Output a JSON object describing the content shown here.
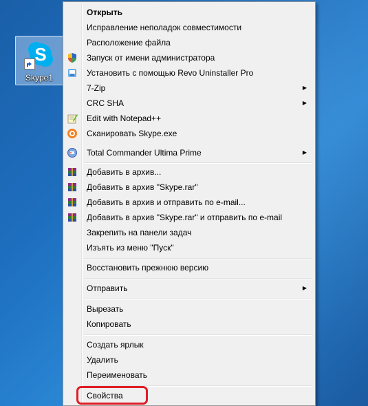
{
  "desktop": {
    "icon_label": "Skype1"
  },
  "menu": {
    "items": {
      "open": "Открыть",
      "compat": "Исправление неполадок совместимости",
      "location": "Расположение файла",
      "runas": "Запуск от имени администратора",
      "revo": "Установить с помощью Revo Uninstaller Pro",
      "zip": "7-Zip",
      "crc": "CRC SHA",
      "notepad": "Edit with Notepad++",
      "scan": "Сканировать Skype.exe",
      "tc": "Total Commander Ultima Prime",
      "add_archive": "Добавить в архив...",
      "add_skype_rar": "Добавить в архив \"Skype.rar\"",
      "add_email": "Добавить в архив и отправить по e-mail...",
      "add_skype_email": "Добавить в архив \"Skype.rar\" и отправить по e-mail",
      "pin_taskbar": "Закрепить на панели задач",
      "unpin_start": "Изъять из меню \"Пуск\"",
      "restore": "Восстановить прежнюю версию",
      "send": "Отправить",
      "cut": "Вырезать",
      "copy": "Копировать",
      "shortcut": "Создать ярлык",
      "delete": "Удалить",
      "rename": "Переименовать",
      "properties": "Свойства"
    }
  },
  "colors": {
    "highlight": "#e01c24",
    "menu_bg": "#f0f0f0"
  }
}
